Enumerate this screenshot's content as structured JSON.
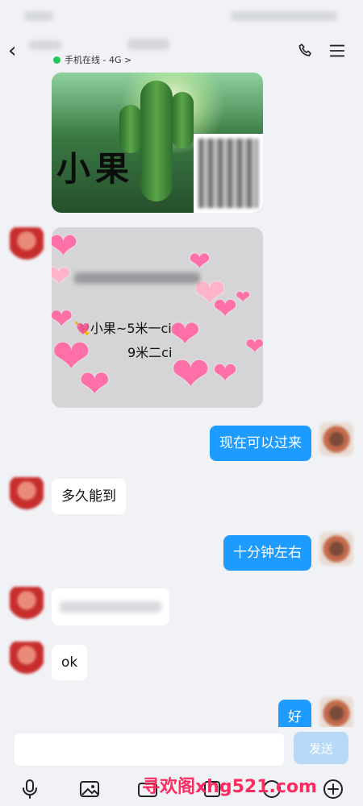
{
  "header": {
    "online_status": "手机在线 - 4G >"
  },
  "messages": {
    "image_name_text": "小果",
    "price_line1": "💘小果~5米一ci",
    "price_line2": "9米二ci",
    "msg_out_1": "现在可以过来",
    "msg_in_1": "多久能到",
    "msg_out_2": "十分钟左右",
    "msg_in_3": "ok",
    "msg_out_3": "好"
  },
  "input": {
    "send_label": "发送"
  },
  "watermark": {
    "text": "寻欢阁xhg521.com"
  },
  "colors": {
    "out_bubble": "#1e9bff",
    "in_bubble": "#ffffff",
    "online_dot": "#22c55e"
  }
}
